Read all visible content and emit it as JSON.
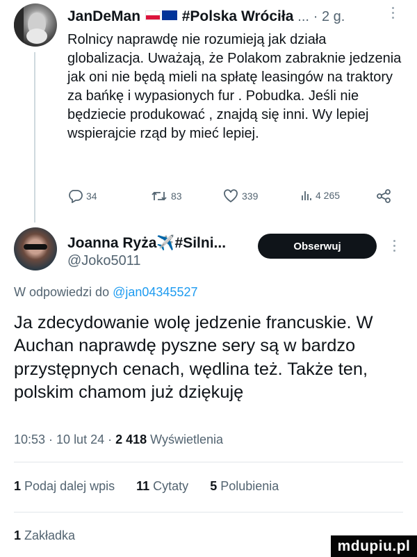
{
  "parent_tweet": {
    "author_name": "JanDeMan",
    "author_suffix": "#Polska Wróciła",
    "ellipsis": "...",
    "time": "· 2 g.",
    "text": "Rolnicy naprawdę nie rozumieją jak działa globalizacja. Uważają, że Polakom zabraknie jedzenia jak oni nie będą mieli na spłatę leasingów na traktory za bańkę i wypasionych fur . Pobudka. Jeśli nie będziecie produkować , znajdą się inni. Wy lepiej wspierajcie rząd by mieć lepiej.",
    "replies": "34",
    "retweets": "83",
    "likes": "339",
    "views": "4 265"
  },
  "main_tweet": {
    "author_name": "Joanna Ryża✈️#Silni...",
    "handle": "@Joko5011",
    "follow_label": "Obserwuj",
    "reply_prefix": "W odpowiedzi do",
    "reply_to": "@jan04345527",
    "text": "Ja zdecydowanie wolę jedzenie francuskie. W Auchan naprawdę pyszne sery są w bardzo przystępnych cenach, wędlina też. Także ten, polskim chamom już dziękuję",
    "time_date": "10:53 · 10 lut 24 ·",
    "views_count": "2 418",
    "views_label": "Wyświetlenia"
  },
  "stats": {
    "reposts_count": "1",
    "reposts_label": "Podaj dalej wpis",
    "quotes_count": "11",
    "quotes_label": "Cytaty",
    "likes_count": "5",
    "likes_label": "Polubienia",
    "bookmarks_count": "1",
    "bookmarks_label": "Zakładka"
  },
  "watermark": "mdupiu.pl",
  "colors": {
    "text": "#0f1419",
    "muted": "#536471",
    "link": "#1d9bf0",
    "button_bg": "#0f1419"
  }
}
